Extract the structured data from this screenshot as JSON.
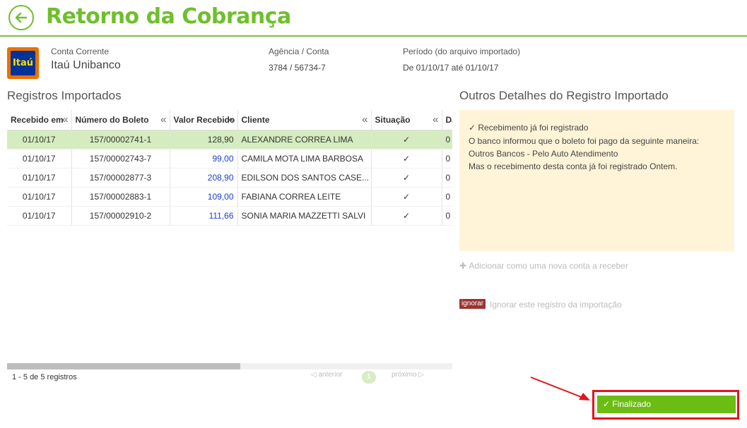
{
  "header": {
    "title": "Retorno da Cobrança",
    "back_icon": "arrow-left-circle-icon"
  },
  "account": {
    "logo_text": "Itaú",
    "conta_label": "Conta Corrente",
    "conta_value": "Itaú Unibanco",
    "agencia_label": "Agência / Conta",
    "agencia_value": "3784 / 56734-7",
    "periodo_label": "Período (do arquivo importado)",
    "periodo_value": "De 01/10/17 até 01/10/17"
  },
  "registros": {
    "title": "Registros Importados",
    "columns": [
      "Recebido em",
      "Número do Boleto",
      "Valor Recebido",
      "Cliente",
      "Situação",
      "Da"
    ],
    "rows": [
      {
        "recebido": "01/10/17",
        "boleto": "157/00002741-1",
        "valor": "128,90",
        "cliente": "ALEXANDRE CORREA LIMA",
        "situacao": "✓",
        "extra": "0"
      },
      {
        "recebido": "01/10/17",
        "boleto": "157/00002743-7",
        "valor": "99,00",
        "cliente": "CAMILA MOTA LIMA BARBOSA",
        "situacao": "✓",
        "extra": "0"
      },
      {
        "recebido": "01/10/17",
        "boleto": "157/00002877-3",
        "valor": "208,90",
        "cliente": "EDILSON DOS SANTOS CASE...",
        "situacao": "✓",
        "extra": "0"
      },
      {
        "recebido": "01/10/17",
        "boleto": "157/00002883-1",
        "valor": "109,00",
        "cliente": "FABIANA CORREA LEITE",
        "situacao": "✓",
        "extra": "0"
      },
      {
        "recebido": "01/10/17",
        "boleto": "157/00002910-2",
        "valor": "111,66",
        "cliente": "SONIA MARIA MAZZETTI SALVI",
        "situacao": "✓",
        "extra": "0"
      }
    ],
    "pager_info": "1 - 5 de 5 registros",
    "prev_label": "anterior",
    "next_label": "próximo",
    "current_page": "1"
  },
  "detalhes": {
    "title": "Outros Detalhes do Registro Importado",
    "status_line": "✓ Recebimento já foi registrado",
    "line1": "O banco informou que o boleto foi pago da seguinte maneira:",
    "line2": "Outros Bancos - Pelo Auto Atendimento",
    "line3": "Mas o recebimento desta conta já foi registrado Ontem.",
    "add_label": "Adicionar como uma nova conta a receber",
    "ignore_tag": "ignorar",
    "ignore_label": "Ignorar este registro da importação"
  },
  "finalizado": {
    "label": "✓  Finalizado"
  },
  "colors": {
    "accent": "#6fbf2c",
    "selected_row": "#d4ecbf",
    "details_bg": "#fff4d7",
    "highlight_frame": "#e3141b"
  }
}
